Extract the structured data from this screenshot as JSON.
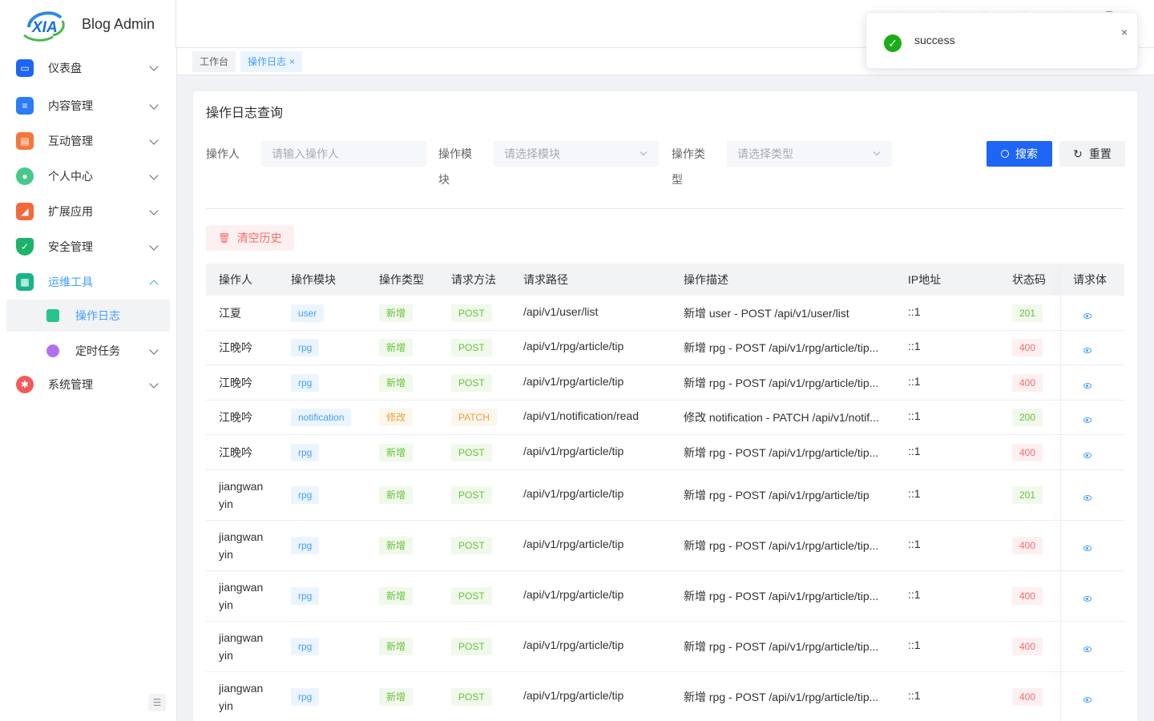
{
  "app": {
    "title": "Blog Admin",
    "logo_text": "XIA"
  },
  "sidebar": {
    "items": [
      {
        "label": "仪表盘",
        "color": "#1d65f5"
      },
      {
        "label": "内容管理",
        "color": "#2b7cf6"
      },
      {
        "label": "互动管理",
        "color": "#f5763b"
      },
      {
        "label": "个人中心",
        "color": "#46c98a"
      },
      {
        "label": "扩展应用",
        "color": "#f26a39"
      },
      {
        "label": "安全管理",
        "color": "#1db36a"
      },
      {
        "label": "运维工具",
        "color": "#17b38a"
      }
    ],
    "sub_items": [
      {
        "label": "操作日志"
      },
      {
        "label": "定时任务"
      }
    ],
    "last_item": {
      "label": "系统管理",
      "color": "#f25a5a"
    }
  },
  "tabs": [
    {
      "label": "工作台"
    },
    {
      "label": "操作日志",
      "close": "×"
    }
  ],
  "card": {
    "title": "操作日志查询"
  },
  "form": {
    "operator_label": "操作人",
    "operator_placeholder": "请输入操作人",
    "module_label_1": "操作模",
    "module_label_2": "块",
    "module_placeholder": "请选择模块",
    "type_label_1": "操作类",
    "type_label_2": "型",
    "type_placeholder": "请选择类型",
    "search_label": "搜索",
    "reset_label": "重置",
    "clear_label": "清空历史"
  },
  "table": {
    "headers": [
      "操作人",
      "操作模块",
      "操作类型",
      "请求方法",
      "请求路径",
      "操作描述",
      "IP地址",
      "状态码",
      "请求体"
    ],
    "rows": [
      {
        "user": "江夏",
        "user2": "",
        "module": "user",
        "type": "新增",
        "method": "POST",
        "path": "/api/v1/user/list",
        "desc": "新增 user - POST /api/v1/user/list",
        "ip": "::1",
        "status": "201"
      },
      {
        "user": "江晚吟",
        "user2": "",
        "module": "rpg",
        "type": "新增",
        "method": "POST",
        "path": "/api/v1/rpg/article/tip",
        "desc": "新增 rpg - POST /api/v1/rpg/article/tip...",
        "ip": "::1",
        "status": "400"
      },
      {
        "user": "江晚吟",
        "user2": "",
        "module": "rpg",
        "type": "新增",
        "method": "POST",
        "path": "/api/v1/rpg/article/tip",
        "desc": "新增 rpg - POST /api/v1/rpg/article/tip...",
        "ip": "::1",
        "status": "400"
      },
      {
        "user": "江晚吟",
        "user2": "",
        "module": "notification",
        "type": "修改",
        "method": "PATCH",
        "path": "/api/v1/notification/read",
        "desc": "修改 notification - PATCH /api/v1/notif...",
        "ip": "::1",
        "status": "200"
      },
      {
        "user": "江晚吟",
        "user2": "",
        "module": "rpg",
        "type": "新增",
        "method": "POST",
        "path": "/api/v1/rpg/article/tip",
        "desc": "新增 rpg - POST /api/v1/rpg/article/tip...",
        "ip": "::1",
        "status": "400"
      },
      {
        "user": "jiangwan",
        "user2": "yin",
        "module": "rpg",
        "type": "新增",
        "method": "POST",
        "path": "/api/v1/rpg/article/tip",
        "desc": "新增 rpg - POST /api/v1/rpg/article/tip",
        "ip": "::1",
        "status": "201"
      },
      {
        "user": "jiangwan",
        "user2": "yin",
        "module": "rpg",
        "type": "新增",
        "method": "POST",
        "path": "/api/v1/rpg/article/tip",
        "desc": "新增 rpg - POST /api/v1/rpg/article/tip...",
        "ip": "::1",
        "status": "400"
      },
      {
        "user": "jiangwan",
        "user2": "yin",
        "module": "rpg",
        "type": "新增",
        "method": "POST",
        "path": "/api/v1/rpg/article/tip",
        "desc": "新增 rpg - POST /api/v1/rpg/article/tip...",
        "ip": "::1",
        "status": "400"
      },
      {
        "user": "jiangwan",
        "user2": "yin",
        "module": "rpg",
        "type": "新增",
        "method": "POST",
        "path": "/api/v1/rpg/article/tip",
        "desc": "新增 rpg - POST /api/v1/rpg/article/tip...",
        "ip": "::1",
        "status": "400"
      },
      {
        "user": "jiangwan",
        "user2": "yin",
        "module": "rpg",
        "type": "新增",
        "method": "POST",
        "path": "/api/v1/rpg/article/tip",
        "desc": "新增 rpg - POST /api/v1/rpg/article/tip...",
        "ip": "::1",
        "status": "400"
      }
    ]
  },
  "toast": {
    "message": "success",
    "close": "×"
  },
  "colors": {
    "primary": "#1d65f5",
    "link": "#409eff",
    "success": "#67c23a",
    "danger": "#f56c6c",
    "warning": "#e6a23c"
  }
}
